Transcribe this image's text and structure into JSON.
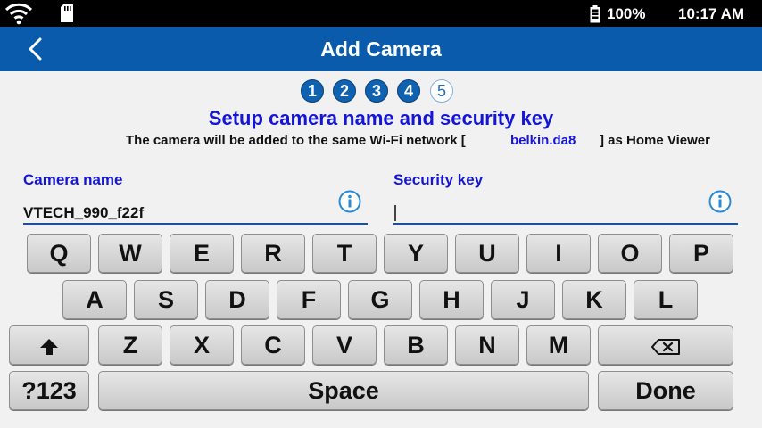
{
  "status": {
    "battery_pct": "100%",
    "time": "10:17 AM"
  },
  "appbar": {
    "title": "Add Camera"
  },
  "steps": {
    "done": [
      "1",
      "2",
      "3",
      "4"
    ],
    "current": "5"
  },
  "setup": {
    "heading": "Setup camera name and security key",
    "line_prefix": "The camera will be added to the same Wi-Fi network [",
    "network": "belkin.da8",
    "line_suffix": "] as Home Viewer"
  },
  "camera_name": {
    "label": "Camera name",
    "value": "VTECH_990_f22f"
  },
  "security_key": {
    "label": "Security key",
    "value": ""
  },
  "keyboard": {
    "row1": [
      "Q",
      "W",
      "E",
      "R",
      "T",
      "Y",
      "U",
      "I",
      "O",
      "P"
    ],
    "row2": [
      "A",
      "S",
      "D",
      "F",
      "G",
      "H",
      "J",
      "K",
      "L"
    ],
    "row3": [
      "Z",
      "X",
      "C",
      "V",
      "B",
      "N",
      "M"
    ],
    "symbols": "?123",
    "space": "Space",
    "done": "Done",
    "icons": {
      "shift": "shift-arrow-icon",
      "backspace": "backspace-icon"
    }
  },
  "colors": {
    "appbar": "#0a5bab",
    "heading": "#1515d6",
    "step_done": "#0e62b0"
  }
}
